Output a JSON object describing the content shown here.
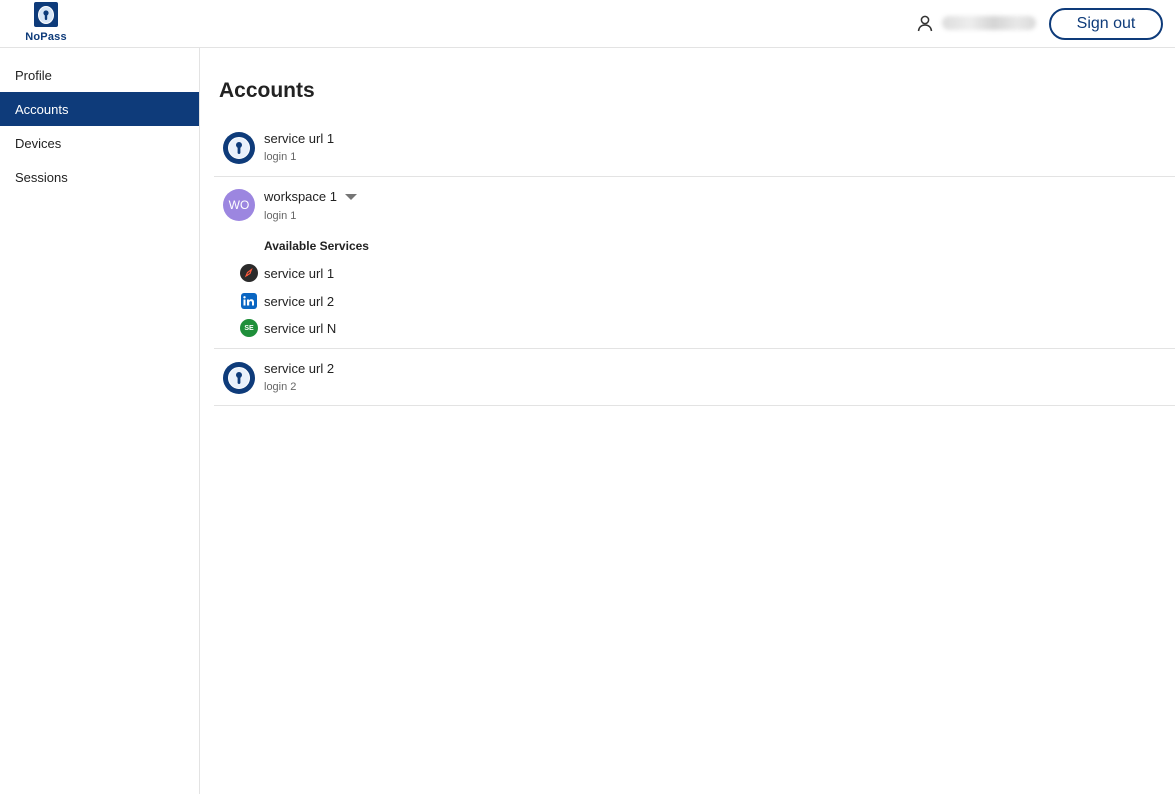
{
  "app": {
    "name": "NoPass",
    "brand_color": "#0e3b7a"
  },
  "header": {
    "user_icon": "user-icon",
    "user_name": "",
    "sign_out_label": "Sign out"
  },
  "sidebar": {
    "items": [
      {
        "label": "Profile",
        "active": false
      },
      {
        "label": "Accounts",
        "active": true
      },
      {
        "label": "Devices",
        "active": false
      },
      {
        "label": "Sessions",
        "active": false
      }
    ]
  },
  "main": {
    "title": "Accounts",
    "accounts": [
      {
        "title": "service url 1",
        "subtitle": "login 1",
        "avatar": "key-icon"
      },
      {
        "title": "workspace 1",
        "subtitle": "login 1",
        "avatar_initials": "WO",
        "avatar_color": "#9c86e0",
        "expanded": true,
        "services_heading": "Available Services",
        "services": [
          {
            "label": "service url 1",
            "icon": "rocket-icon",
            "icon_color": "#2b2b2b"
          },
          {
            "label": "service url 2",
            "icon": "linkedin-icon",
            "icon_color": "#0a66c2"
          },
          {
            "label": "service url N",
            "icon": "se-icon",
            "icon_text": "SE",
            "icon_color": "#1f8f3a"
          }
        ]
      },
      {
        "title": "service url 2",
        "subtitle": "login 2",
        "avatar": "key-icon"
      }
    ]
  }
}
